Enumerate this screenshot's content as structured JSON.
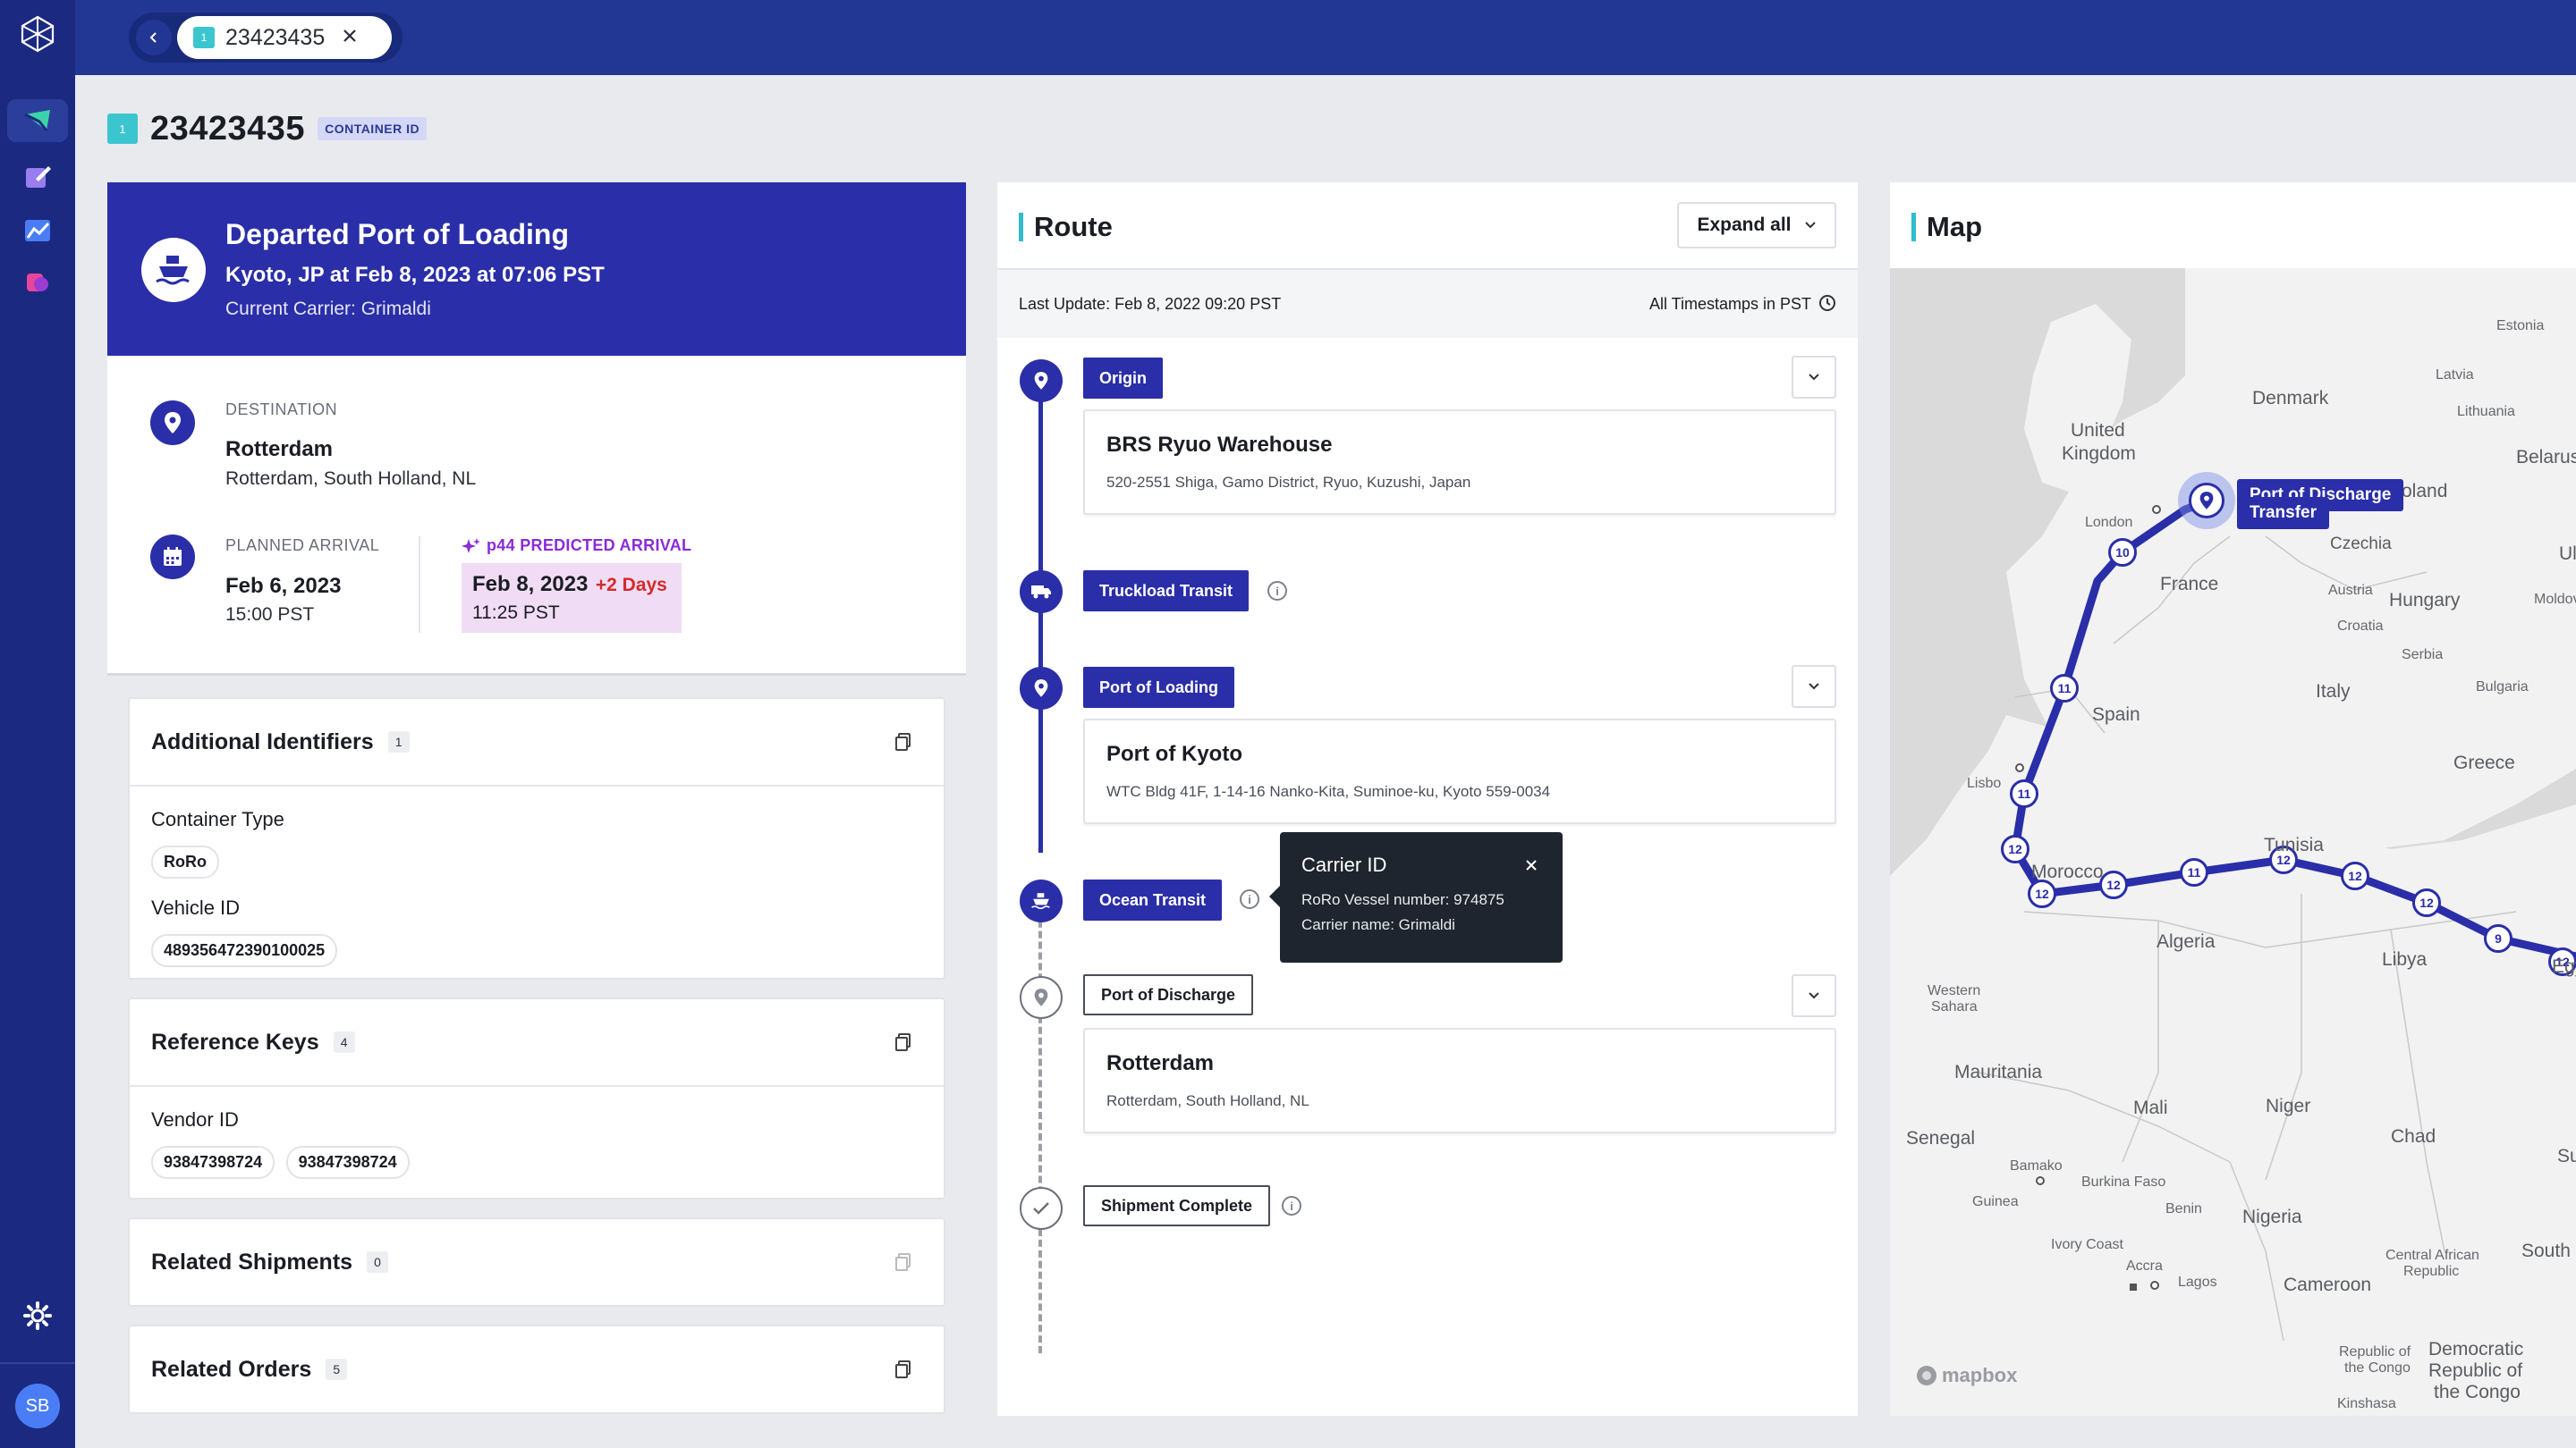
{
  "topbar": {
    "tab": {
      "badge": "1",
      "label": "23423435"
    }
  },
  "sidebar": {
    "avatar": "SB"
  },
  "header": {
    "badge": "1",
    "title": "23423435",
    "id_badge": "CONTAINER ID"
  },
  "status": {
    "title": "Departed Port of Loading",
    "subtitle": "Kyoto, JP at Feb 8, 2023 at 07:06 PST",
    "carrier": "Current Carrier: Grimaldi"
  },
  "destination": {
    "label": "DESTINATION",
    "city": "Rotterdam",
    "region": "Rotterdam, South Holland, NL"
  },
  "arrival": {
    "planned_label": "PLANNED ARRIVAL",
    "planned_date": "Feb 6, 2023",
    "planned_time": "15:00 PST",
    "predicted_label": "p44 PREDICTED ARRIVAL",
    "predicted_date": "Feb 8, 2023",
    "predicted_delta": "+2 Days",
    "predicted_time": "11:25 PST"
  },
  "panels": {
    "additional": {
      "title": "Additional Identifiers",
      "count": "1",
      "container_type_label": "Container Type",
      "container_type": "RoRo",
      "vehicle_id_label": "Vehicle ID",
      "vehicle_id": "489356472390100025"
    },
    "reference": {
      "title": "Reference Keys",
      "count": "4",
      "vendor_label": "Vendor ID",
      "vendor_ids": [
        "93847398724",
        "93847398724"
      ]
    },
    "shipments": {
      "title": "Related Shipments",
      "count": "0"
    },
    "orders": {
      "title": "Related Orders",
      "count": "5"
    }
  },
  "route": {
    "title": "Route",
    "expand_label": "Expand all",
    "last_update": "Last Update: Feb 8, 2022 09:20 PST",
    "timezone": "All Timestamps in PST",
    "steps": [
      {
        "tag": "Origin",
        "name": "BRS Ryuo Warehouse",
        "address": "520-2551 Shiga, Gamo District, Ryuo, Kuzushi, Japan"
      },
      {
        "tag": "Truckload Transit"
      },
      {
        "tag": "Port of Loading",
        "name": "Port of Kyoto",
        "address": "WTC Bldg 41F, 1-14-16 Nanko-Kita, Suminoe-ku, Kyoto 559-0034"
      },
      {
        "tag": "Ocean Transit"
      },
      {
        "tag": "Port of Discharge",
        "name": "Rotterdam",
        "address": "Rotterdam, South Holland, NL"
      },
      {
        "tag": "Shipment Complete"
      }
    ],
    "tooltip": {
      "title": "Carrier ID",
      "line1": "RoRo Vessel number: 974875",
      "line2": "Carrier name: Grimaldi"
    }
  },
  "map": {
    "title": "Map",
    "marker_label": "Port of Discharge",
    "transfer_label": "Transfer",
    "attribution": "mapbox",
    "labels": {
      "estonia": "Estonia",
      "latvia": "Latvia",
      "lithuania": "Lithuania",
      "denmark": "Denmark",
      "uk1": "United",
      "uk2": "Kingdom",
      "belarus": "Belarus",
      "poland": "oland",
      "london": "London",
      "czechia": "Czechia",
      "ukraine": "Ul",
      "france": "France",
      "austria": "Austria",
      "hungary": "Hungary",
      "moldova": "Moldov",
      "croatia": "Croatia",
      "serbia": "Serbia",
      "italy": "Italy",
      "bulgaria": "Bulgaria",
      "spain": "Spain",
      "greece": "Greece",
      "lisbon": "Lisbo",
      "tunisia": "Tunisia",
      "morocco": "Morocco",
      "algeria": "Algeria",
      "libya": "Libya",
      "egypt": "Egy",
      "ws1": "Western",
      "ws2": "Sahara",
      "mauritania": "Mauritania",
      "mali": "Mali",
      "niger": "Niger",
      "chad": "Chad",
      "senegal": "Senegal",
      "sudan": "Suc",
      "bamako": "Bamako",
      "burkina": "Burkina Faso",
      "guinea": "Guinea",
      "benin": "Benin",
      "nigeria": "Nigeria",
      "ivory": "Ivory Coast",
      "accra": "Accra",
      "lagos": "Lagos",
      "car1": "Central African",
      "car2": "Republic",
      "south": "South",
      "cameroon": "Cameroon",
      "roc1": "Republic of",
      "roc2": "the Congo",
      "drc1": "Democratic",
      "drc2": "Republic of",
      "drc3": "the Congo",
      "kinshasa": "Kinshasa"
    },
    "route_markers": [
      "10",
      "11",
      "11",
      "12",
      "12",
      "12",
      "11",
      "12",
      "12",
      "12",
      "9",
      "12"
    ]
  },
  "colors": {
    "primary": "#2a2ea8",
    "topbar": "#223693",
    "accent": "#3bc6cf",
    "sidebar": "#1b2a80",
    "delay": "#d22b2b",
    "predicted_bg": "#f1dcf5"
  }
}
